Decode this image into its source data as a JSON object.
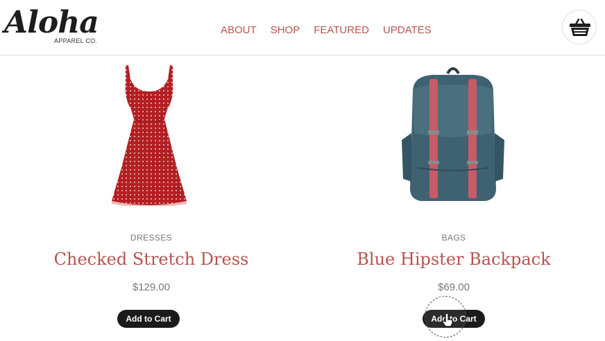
{
  "brand": {
    "logo_script": "Aloha",
    "logo_sub": "APPAREL CO."
  },
  "nav": {
    "items": [
      {
        "label": "ABOUT"
      },
      {
        "label": "SHOP"
      },
      {
        "label": "FEATURED"
      },
      {
        "label": "UPDATES"
      }
    ]
  },
  "header": {
    "cart_icon": "shopping-basket-icon"
  },
  "products": [
    {
      "category": "DRESSES",
      "title": "Checked Stretch Dress",
      "price": "$129.00",
      "button": "Add to Cart",
      "image": "red-polka-dot-dress"
    },
    {
      "category": "BAGS",
      "title": "Blue Hipster Backpack",
      "price": "$69.00",
      "button": "Add to Cart",
      "image": "blue-backpack-with-red-straps"
    }
  ],
  "colors": {
    "accent": "#b5544f",
    "button_bg": "#1b1b1b",
    "muted_text": "#777777",
    "dress_red": "#b31f22",
    "backpack_teal": "#3f6272",
    "strap_pink": "#c85b66"
  }
}
